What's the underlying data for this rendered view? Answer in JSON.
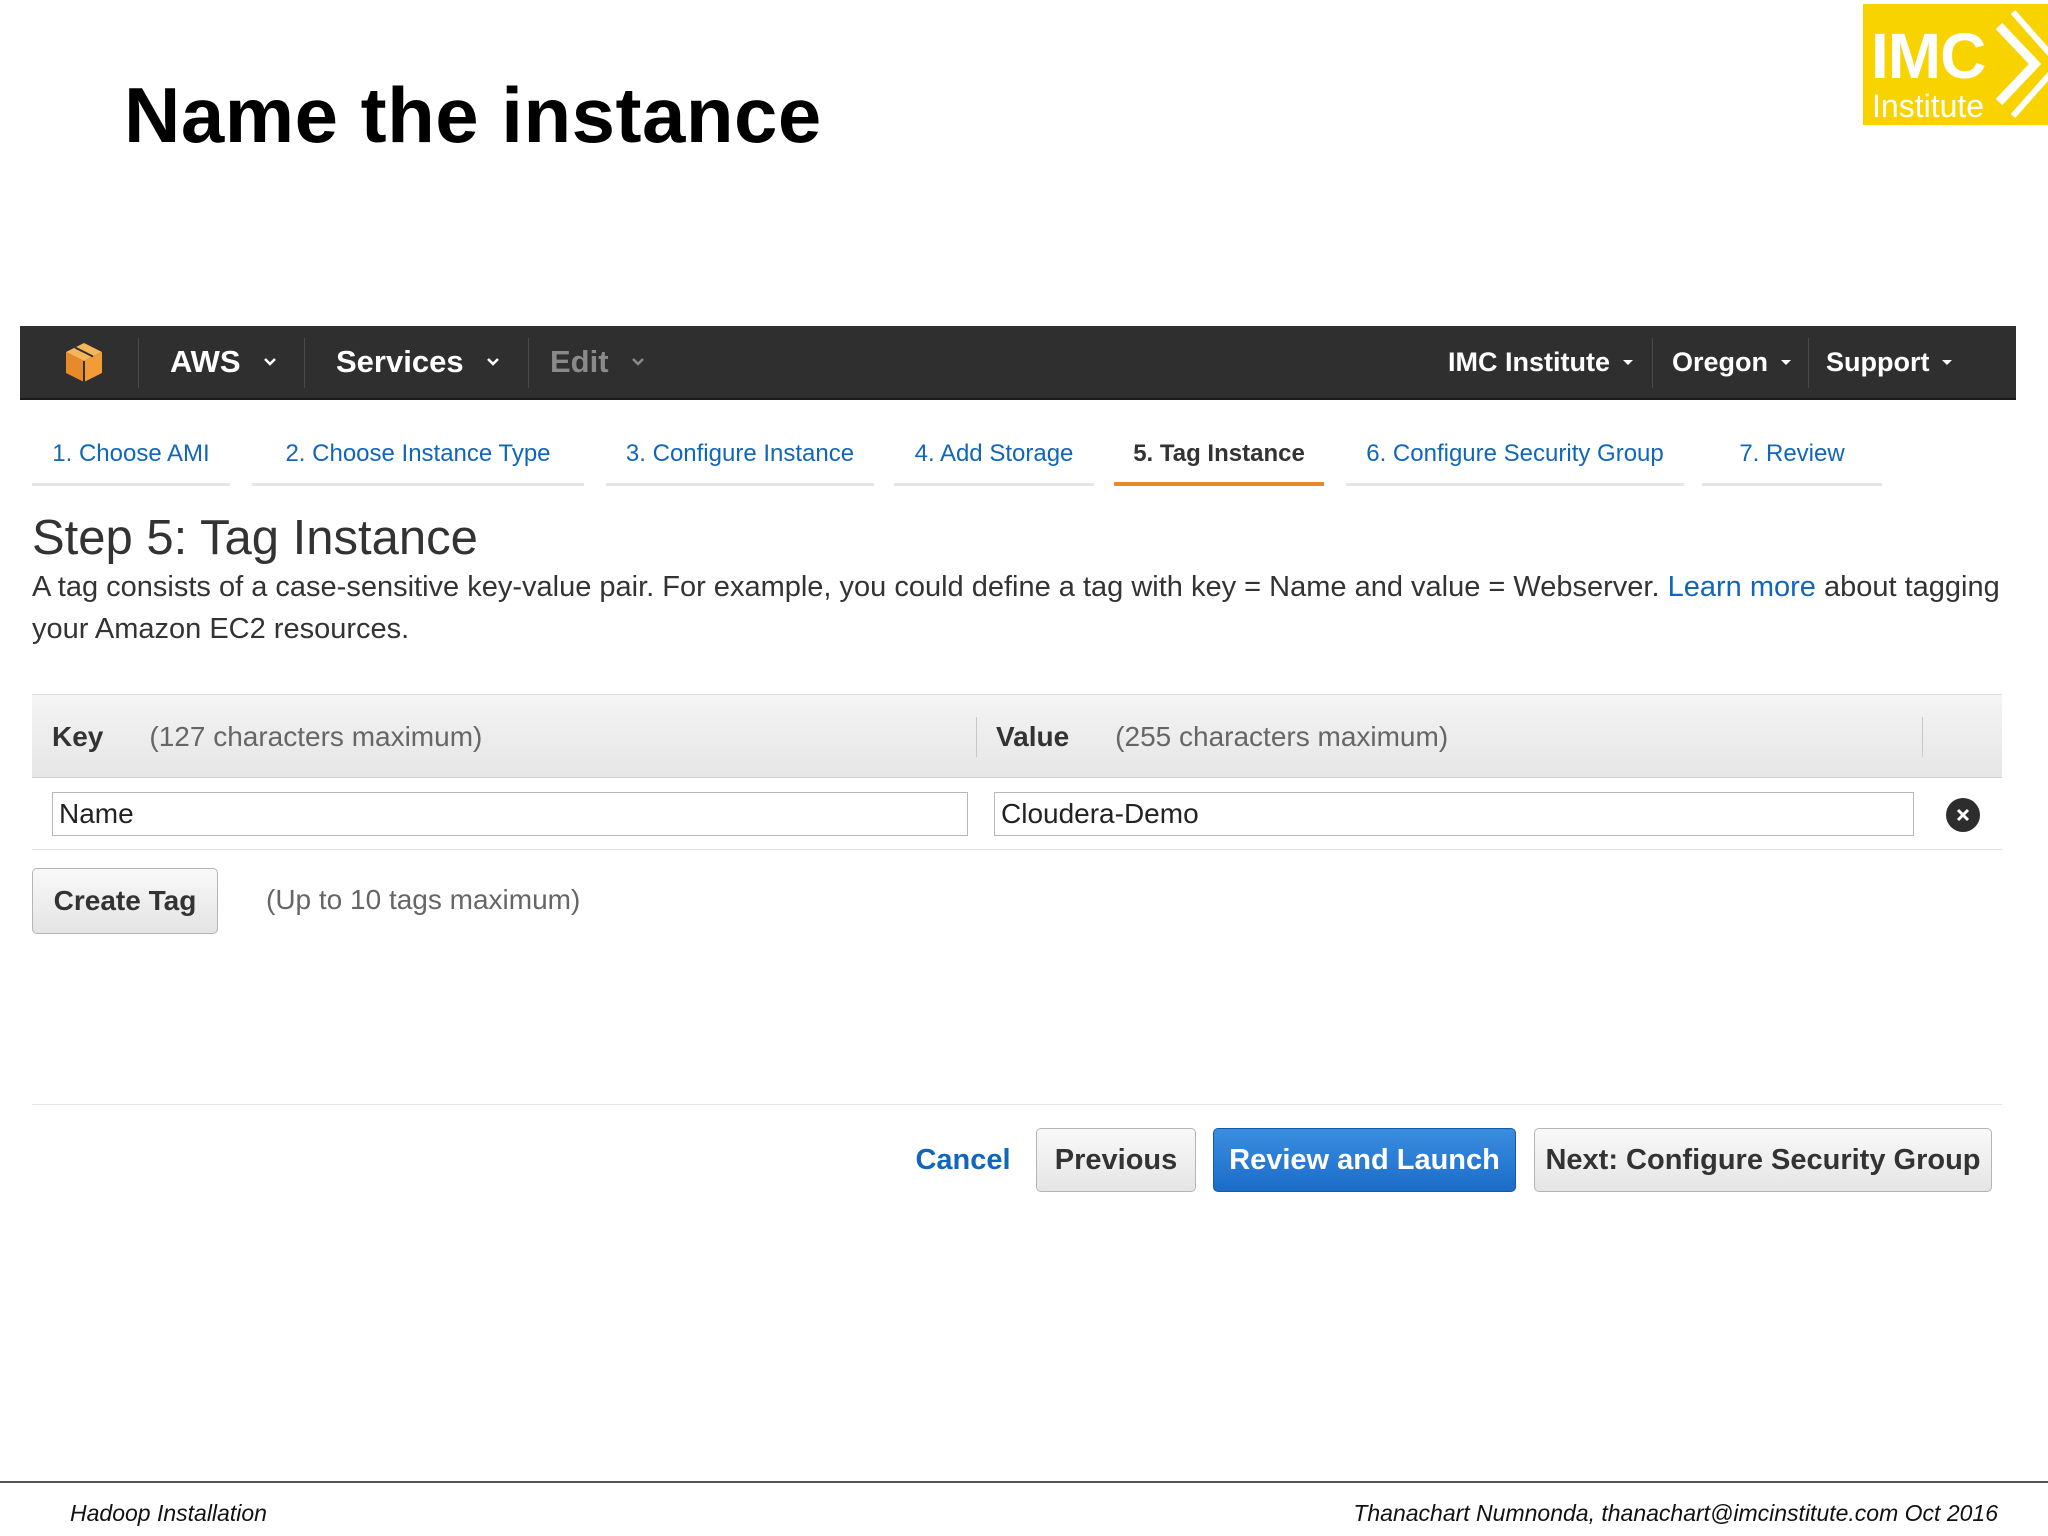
{
  "slide": {
    "title": "Name the instance",
    "logo": {
      "main": "IMC",
      "sub": "Institute"
    },
    "footer_left": "Hadoop Installation",
    "footer_right": "Thanachart Numnonda,  thanachart@imcinstitute.com  Oct 2016"
  },
  "navbar": {
    "brand": "AWS",
    "services": "Services",
    "edit": "Edit",
    "account": "IMC Institute",
    "region": "Oregon",
    "support": "Support"
  },
  "wizard": {
    "tabs": [
      {
        "label": "1. Choose AMI"
      },
      {
        "label": "2. Choose Instance Type"
      },
      {
        "label": "3. Configure Instance"
      },
      {
        "label": "4. Add Storage"
      },
      {
        "label": "5. Tag Instance",
        "active": true
      },
      {
        "label": "6. Configure Security Group"
      },
      {
        "label": "7. Review"
      }
    ]
  },
  "step": {
    "title": "Step 5: Tag Instance",
    "desc_before": "A tag consists of a case-sensitive key-value pair. For example, you could define a tag with key = Name and value = Webserver. ",
    "learn_more": "Learn more",
    "desc_after": " about tagging your Amazon EC2 resources."
  },
  "tags": {
    "key_label": "Key",
    "key_hint": "(127 characters maximum)",
    "value_label": "Value",
    "value_hint": "(255 characters maximum)",
    "rows": [
      {
        "key": "Name",
        "value": "Cloudera-Demo"
      }
    ],
    "create_label": "Create Tag",
    "create_hint": "(Up to 10 tags maximum)"
  },
  "actions": {
    "cancel": "Cancel",
    "previous": "Previous",
    "review_launch": "Review and Launch",
    "next": "Next: Configure Security Group"
  },
  "colors": {
    "nav_bg": "#2f2f2f",
    "link": "#1166bb",
    "active_tab": "#e88a2a",
    "primary": "#1b6cc8",
    "logo_bg": "#f8d300"
  }
}
